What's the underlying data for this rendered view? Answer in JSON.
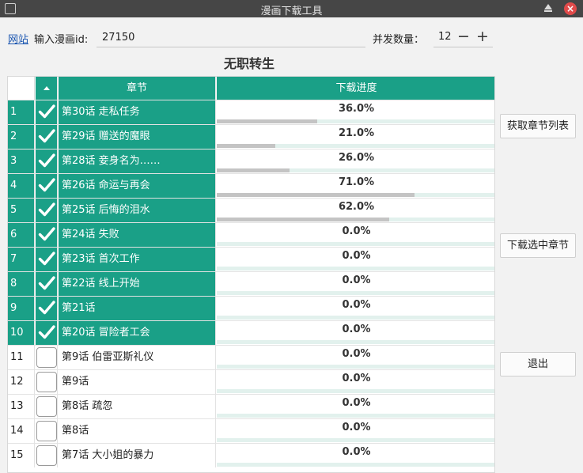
{
  "window": {
    "title": "漫画下载工具"
  },
  "toolbar": {
    "site_link": "网站",
    "id_label": "输入漫画id:",
    "id_value": "27150",
    "concurrency_label": "并发数量：",
    "concurrency_value": "12",
    "minus": "−",
    "plus": "+"
  },
  "comic_title": "无职转生",
  "table": {
    "columns": {
      "chapter": "章节",
      "progress": "下载进度"
    },
    "rows": [
      {
        "num": "1",
        "chapter": "第30话 走私任务",
        "progress": "36.0%",
        "fraction": 0.36,
        "checked": true
      },
      {
        "num": "2",
        "chapter": "第29话 赠送的魔眼",
        "progress": "21.0%",
        "fraction": 0.21,
        "checked": true
      },
      {
        "num": "3",
        "chapter": "第28话 妾身名为……",
        "progress": "26.0%",
        "fraction": 0.26,
        "checked": true
      },
      {
        "num": "4",
        "chapter": "第26话 命运与再会",
        "progress": "71.0%",
        "fraction": 0.71,
        "checked": true
      },
      {
        "num": "5",
        "chapter": "第25话 后悔的泪水",
        "progress": "62.0%",
        "fraction": 0.62,
        "checked": true
      },
      {
        "num": "6",
        "chapter": "第24话 失败",
        "progress": "0.0%",
        "fraction": 0.0,
        "checked": true
      },
      {
        "num": "7",
        "chapter": "第23话 首次工作",
        "progress": "0.0%",
        "fraction": 0.0,
        "checked": true
      },
      {
        "num": "8",
        "chapter": "第22话 线上开始",
        "progress": "0.0%",
        "fraction": 0.0,
        "checked": true
      },
      {
        "num": "9",
        "chapter": "第21话",
        "progress": "0.0%",
        "fraction": 0.0,
        "checked": true
      },
      {
        "num": "10",
        "chapter": "第20话 冒险者工会",
        "progress": "0.0%",
        "fraction": 0.0,
        "checked": true
      },
      {
        "num": "11",
        "chapter": "第9话 伯雷亚斯礼仪",
        "progress": "0.0%",
        "fraction": 0.0,
        "checked": false
      },
      {
        "num": "12",
        "chapter": "第9话",
        "progress": "0.0%",
        "fraction": 0.0,
        "checked": false
      },
      {
        "num": "13",
        "chapter": "第8话 疏忽",
        "progress": "0.0%",
        "fraction": 0.0,
        "checked": false
      },
      {
        "num": "14",
        "chapter": "第8话",
        "progress": "0.0%",
        "fraction": 0.0,
        "checked": false
      },
      {
        "num": "15",
        "chapter": "第7话 大小姐的暴力",
        "progress": "0.0%",
        "fraction": 0.0,
        "checked": false
      }
    ]
  },
  "buttons": {
    "fetch": "获取章节列表",
    "download": "下载选中章节",
    "exit": "退出"
  },
  "colors": {
    "accent": "#1aa087",
    "progress_fill": "#c4c4c4",
    "track": "#e2f1ed"
  }
}
